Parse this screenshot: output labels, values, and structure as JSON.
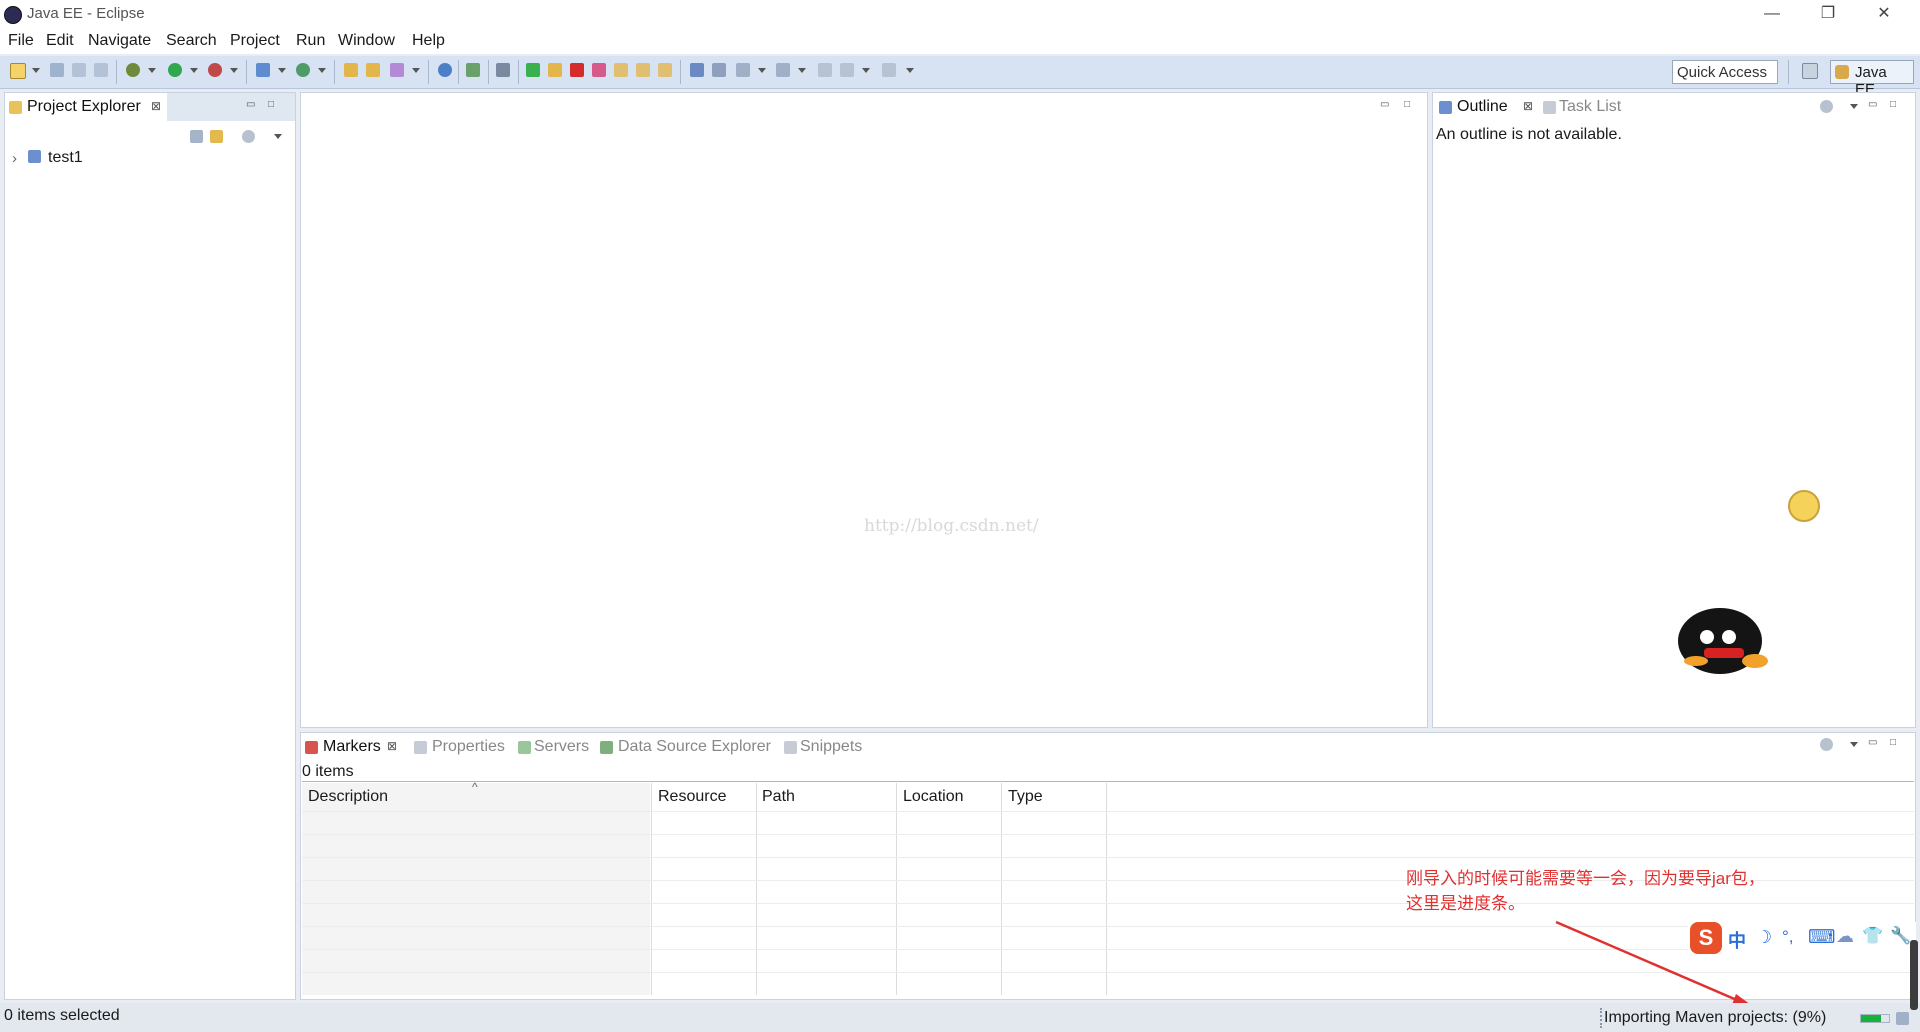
{
  "window": {
    "title": "Java EE - Eclipse",
    "controls": [
      "—",
      "❐",
      "✕"
    ]
  },
  "menu": [
    "File",
    "Edit",
    "Navigate",
    "Search",
    "Project",
    "Run",
    "Window",
    "Help"
  ],
  "toolbar": {
    "quick_access": "Quick Access",
    "perspective": "Java EE"
  },
  "project_explorer": {
    "tab": "Project Explorer",
    "tree": [
      {
        "label": "test1",
        "expand": "›"
      }
    ]
  },
  "editor": {
    "watermark": "http://blog.csdn.net/"
  },
  "outline": {
    "tabs": [
      {
        "label": "Outline",
        "active": true
      },
      {
        "label": "Task List",
        "active": false
      }
    ],
    "message": "An outline is not available."
  },
  "bottom": {
    "tabs": [
      {
        "label": "Markers",
        "active": true
      },
      {
        "label": "Properties",
        "active": false
      },
      {
        "label": "Servers",
        "active": false
      },
      {
        "label": "Data Source Explorer",
        "active": false
      },
      {
        "label": "Snippets",
        "active": false
      }
    ],
    "count": "0 items",
    "sort_indicator": "^",
    "columns": [
      "Description",
      "Resource",
      "Path",
      "Location",
      "Type"
    ]
  },
  "annotation": {
    "line1": "刚导入的时候可能需要等一会，因为要导jar包，",
    "line2": "这里是进度条。"
  },
  "ime": {
    "logo": "S",
    "items": [
      "中",
      "☽",
      "°,",
      "⌨",
      "☁",
      "👕",
      "🔧"
    ]
  },
  "status": {
    "left": "0 items selected",
    "progress_text": "Importing Maven projects: (9%)",
    "progress": 0.09
  },
  "colors": {
    "accent": "#d7e3f2",
    "annotation": "#e03030",
    "progress": "#16b33c"
  }
}
